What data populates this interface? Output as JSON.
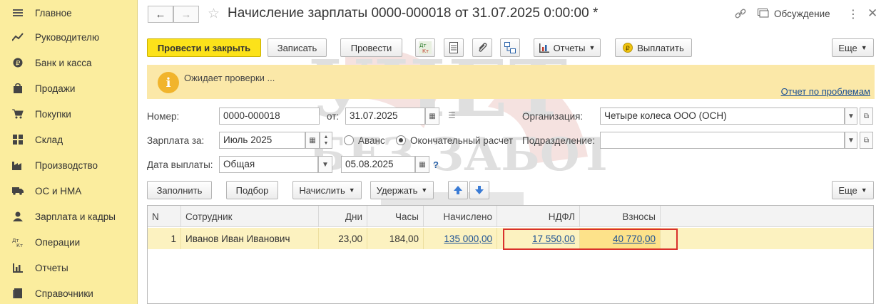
{
  "sidebar": {
    "items": [
      {
        "label": "Главное",
        "icon": "menu-icon"
      },
      {
        "label": "Руководителю",
        "icon": "trend-icon"
      },
      {
        "label": "Банк и касса",
        "icon": "coin-icon"
      },
      {
        "label": "Продажи",
        "icon": "bag-icon"
      },
      {
        "label": "Покупки",
        "icon": "cart-icon"
      },
      {
        "label": "Склад",
        "icon": "warehouse-icon"
      },
      {
        "label": "Производство",
        "icon": "factory-icon"
      },
      {
        "label": "ОС и НМА",
        "icon": "truck-icon"
      },
      {
        "label": "Зарплата и кадры",
        "icon": "person-icon"
      },
      {
        "label": "Операции",
        "icon": "dt-kt-icon"
      },
      {
        "label": "Отчеты",
        "icon": "barchart-icon"
      },
      {
        "label": "Справочники",
        "icon": "book-icon"
      }
    ]
  },
  "header": {
    "title": "Начисление зарплаты 0000-000018 от 31.07.2025 0:00:00 *",
    "discussion_label": "Обсуждение"
  },
  "toolbar": {
    "post_close": "Провести и закрыть",
    "save": "Записать",
    "post": "Провести",
    "reports": "Отчеты",
    "pay": "Выплатить",
    "more": "Еще",
    "dt_kt": "Дт Кт"
  },
  "warning": {
    "text": "Ожидает проверки ...",
    "link": "Отчет по проблемам"
  },
  "form": {
    "number_label": "Номер:",
    "number_value": "0000-000018",
    "from_label": "от:",
    "date_value": "31.07.2025",
    "org_label": "Организация:",
    "org_value": "Четыре колеса ООО (ОСН)",
    "salary_for_label": "Зарплата за:",
    "salary_for_value": "Июль 2025",
    "advance_label": "Аванс",
    "final_label": "Окончательный расчет",
    "dept_label": "Подразделение:",
    "dept_value": "",
    "payday_label": "Дата выплаты:",
    "payday_type": "Общая",
    "payday_date": "05.08.2025",
    "help": "?"
  },
  "table_toolbar": {
    "fill": "Заполнить",
    "select": "Подбор",
    "accrue": "Начислить",
    "withhold": "Удержать",
    "more": "Еще"
  },
  "table": {
    "columns": [
      "N",
      "Сотрудник",
      "Дни",
      "Часы",
      "Начислено",
      "НДФЛ",
      "Взносы"
    ],
    "rows": [
      {
        "n": "1",
        "employee": "Иванов Иван Иванович",
        "days": "23,00",
        "hours": "184,00",
        "accrued": "135 000,00",
        "ndfl": "17 550,00",
        "contrib": "40 770,00"
      }
    ]
  },
  "watermark": {
    "line1": "УЧЕТ",
    "line2": "БЕЗ ЗАБОТ"
  }
}
